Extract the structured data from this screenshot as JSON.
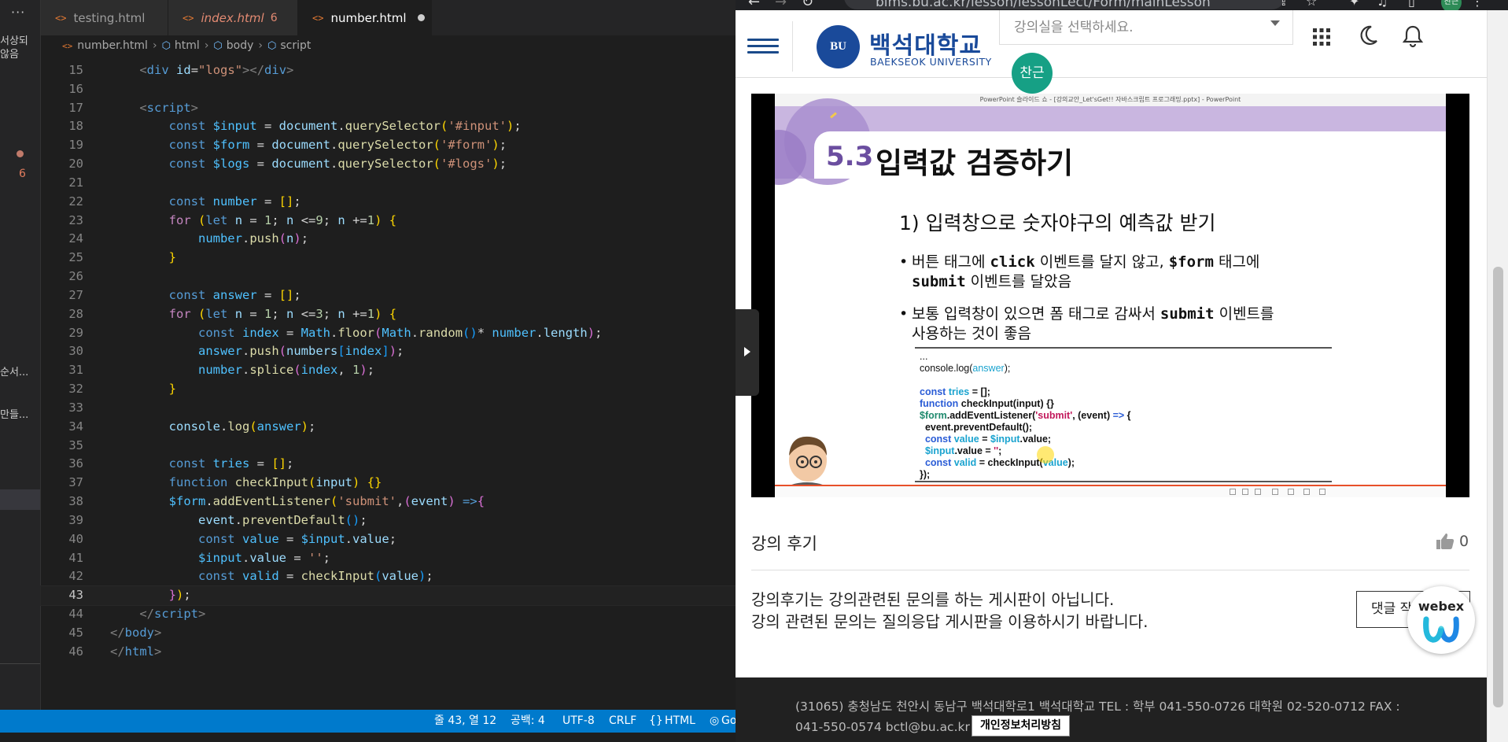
{
  "vscode": {
    "activity_clips": [
      "서상되",
      "않음",
      "순서...",
      "만들..."
    ],
    "problem_count": "6",
    "tabs": [
      {
        "label": "testing.html",
        "state": "normal"
      },
      {
        "label": "index.html",
        "badge": "6",
        "state": "modified-error"
      },
      {
        "label": "number.html",
        "state": "active-dirty"
      }
    ],
    "breadcrumb": [
      "number.html",
      "html",
      "body",
      "script"
    ],
    "code_lines": [
      {
        "n": 15,
        "html": "    <span class='tg'>&lt;</span><span class='tn'>div</span> <span class='at'>id</span>=<span class='st'>\"logs\"</span><span class='tg'>&gt;&lt;/</span><span class='tn'>div</span><span class='tg'>&gt;</span>"
      },
      {
        "n": 16,
        "html": ""
      },
      {
        "n": 17,
        "html": "    <span class='tg'>&lt;</span><span class='tn'>script</span><span class='tg'>&gt;</span>"
      },
      {
        "n": 18,
        "html": "        <span class='kw'>const</span> <span class='vr'>$input</span> = <span class='va'>document</span>.<span class='fn'>querySelector</span><span class='p1'>(</span><span class='st'>'#input'</span><span class='p1'>)</span>;"
      },
      {
        "n": 19,
        "html": "        <span class='kw'>const</span> <span class='vr'>$form</span> = <span class='va'>document</span>.<span class='fn'>querySelector</span><span class='p1'>(</span><span class='st'>'#form'</span><span class='p1'>)</span>;"
      },
      {
        "n": 20,
        "html": "        <span class='kw'>const</span> <span class='vr'>$logs</span> = <span class='va'>document</span>.<span class='fn'>querySelector</span><span class='p1'>(</span><span class='st'>'#logs'</span><span class='p1'>)</span>;"
      },
      {
        "n": 21,
        "html": ""
      },
      {
        "n": 22,
        "html": "        <span class='kw'>const</span> <span class='vr'>number</span> = <span class='p1'>[]</span>;"
      },
      {
        "n": 23,
        "html": "        <span class='ct'>for</span> <span class='p1'>(</span><span class='kw'>let</span> <span class='va'>n</span> = <span class='nu'>1</span>; <span class='va'>n</span> &lt;=<span class='nu'>9</span>; <span class='va'>n</span> +=<span class='nu'>1</span><span class='p1'>)</span> <span class='p1'>{</span>"
      },
      {
        "n": 24,
        "html": "            <span class='vr'>number</span>.<span class='fn'>push</span><span class='p2'>(</span><span class='va'>n</span><span class='p2'>)</span>;"
      },
      {
        "n": 25,
        "html": "        <span class='p1'>}</span>"
      },
      {
        "n": 26,
        "html": ""
      },
      {
        "n": 27,
        "html": "        <span class='kw'>const</span> <span class='vr'>answer</span> = <span class='p1'>[]</span>;"
      },
      {
        "n": 28,
        "html": "        <span class='ct'>for</span> <span class='p1'>(</span><span class='kw'>let</span> <span class='va'>n</span> = <span class='nu'>1</span>; <span class='va'>n</span> &lt;=<span class='nu'>3</span>; <span class='va'>n</span> +=<span class='nu'>1</span><span class='p1'>)</span> <span class='p1'>{</span>"
      },
      {
        "n": 29,
        "html": "            <span class='kw'>const</span> <span class='vr'>index</span> = <span class='vr'>Math</span>.<span class='fn'>floor</span><span class='p2'>(</span><span class='vr'>Math</span>.<span class='fn'>random</span><span class='p3'>()</span>* <span class='vr'>number</span>.<span class='va'>length</span><span class='p2'>)</span>;"
      },
      {
        "n": 30,
        "html": "            <span class='vr'>answer</span>.<span class='fn'>push</span><span class='p2'>(</span><span class='va'>numbers</span><span class='p3'>[</span><span class='vr'>index</span><span class='p3'>]</span><span class='p2'>)</span>;"
      },
      {
        "n": 31,
        "html": "            <span class='vr'>number</span>.<span class='fn'>splice</span><span class='p2'>(</span><span class='vr'>index</span>, <span class='nu'>1</span><span class='p2'>)</span>;"
      },
      {
        "n": 32,
        "html": "        <span class='p1'>}</span>"
      },
      {
        "n": 33,
        "html": ""
      },
      {
        "n": 34,
        "html": "        <span class='va'>console</span>.<span class='fn'>log</span><span class='p1'>(</span><span class='vr'>answer</span><span class='p1'>)</span>;"
      },
      {
        "n": 35,
        "html": ""
      },
      {
        "n": 36,
        "html": "        <span class='kw'>const</span> <span class='vr'>tries</span> = <span class='p1'>[]</span>;"
      },
      {
        "n": 37,
        "html": "        <span class='kw'>function</span> <span class='fn'>checkInput</span><span class='p1'>(</span><span class='va'>input</span><span class='p1'>)</span> <span class='p1'>{}</span>"
      },
      {
        "n": 38,
        "html": "        <span class='vr'>$form</span>.<span class='fn'>addEventListener</span><span class='p1'>(</span><span class='st'>'submit'</span>,<span class='p2'>(</span><span class='va'>event</span><span class='p2'>)</span> <span class='kw'>=&gt;</span><span class='p2'>{</span>"
      },
      {
        "n": 39,
        "html": "            <span class='va'>event</span>.<span class='fn'>preventDefault</span><span class='p3'>()</span>;"
      },
      {
        "n": 40,
        "html": "            <span class='kw'>const</span> <span class='vr'>value</span> = <span class='vr'>$input</span>.<span class='va'>value</span>;"
      },
      {
        "n": 41,
        "html": "            <span class='vr'>$input</span>.<span class='va'>value</span> = <span class='st'>''</span>;"
      },
      {
        "n": 42,
        "html": "            <span class='kw'>const</span> <span class='vr'>valid</span> = <span class='fn'>checkInput</span><span class='p3'>(</span><span class='va'>value</span><span class='p3'>)</span>;"
      },
      {
        "n": 43,
        "html": "        <span class='p2'>}</span><span class='p1'>)</span>;",
        "current": true
      },
      {
        "n": 44,
        "html": "    <span class='tg'>&lt;/</span><span class='tn'>script</span><span class='tg'>&gt;</span>"
      },
      {
        "n": 45,
        "html": "<span class='tg'>&lt;/</span><span class='tn'>body</span><span class='tg'>&gt;</span>"
      },
      {
        "n": 46,
        "html": "<span class='tg'>&lt;/</span><span class='tn'>html</span><span class='tg'>&gt;</span>"
      }
    ],
    "status": {
      "position": "줄 43, 열 12",
      "spaces": "공백: 4",
      "encoding": "UTF-8",
      "eol": "CRLF",
      "language": "HTML",
      "golive": "Go"
    }
  },
  "browser": {
    "url": "bims.bu.ac.kr/lesson/lessonLect/Form/mainLesson",
    "profile": "찬근",
    "site": {
      "logo_mark": "BU",
      "logo_ko": "백석대학교",
      "logo_en": "BAEKSEOK UNIVERSITY",
      "classroom_placeholder": "강의실을 선택하세요.",
      "user_chip": "찬근"
    },
    "slide": {
      "window_title": "PowerPoint 슬라이드 쇼 - [강의교안_Let'sGet!! 자바스크립트 프로그래밍.pptx] - PowerPoint",
      "section_num": "5.3",
      "title": "입력값 검증하기",
      "subtitle": "1) 입력창으로 숫자야구의 예측값 받기",
      "bullets": [
        "버튼 태그에 click 이벤트를 달지 않고, $form 태그에\nsubmit 이벤트를 달았음",
        "보통 입력창이 있으면 폼 태그로 감싸서 submit 이벤트를\n사용하는 것이 좋음"
      ],
      "code_lines": [
        "...",
        "console.log(answer);",
        "",
        "const tries = [];",
        "function checkInput(input) {}",
        "$form.addEventListener('submit', (event) => {",
        "  event.preventDefault();",
        "  const value = $input.value;",
        "  $input.value = '';",
        "  const valid = checkInput(value);",
        "});"
      ]
    },
    "review": {
      "title": "강의 후기",
      "likes": "0",
      "notice": "강의후기는 강의관련된 문의를 하는 게시판이 아닙니다.\n강의 관련된 문의는 질의응답 게시판을 이용하시기 바랍니다.",
      "comment_button": "댓글 작성",
      "webex_label": "webex"
    },
    "footer": {
      "address": "(31065) 충청남도 천안시 동남구 백석대학로1 백석대학교 TEL : 학부 041-550-0726 대학원 02-520-0712 FAX : 041-550-0574 bctl@bu.ac.kr",
      "privacy": "개인정보처리방침"
    }
  }
}
